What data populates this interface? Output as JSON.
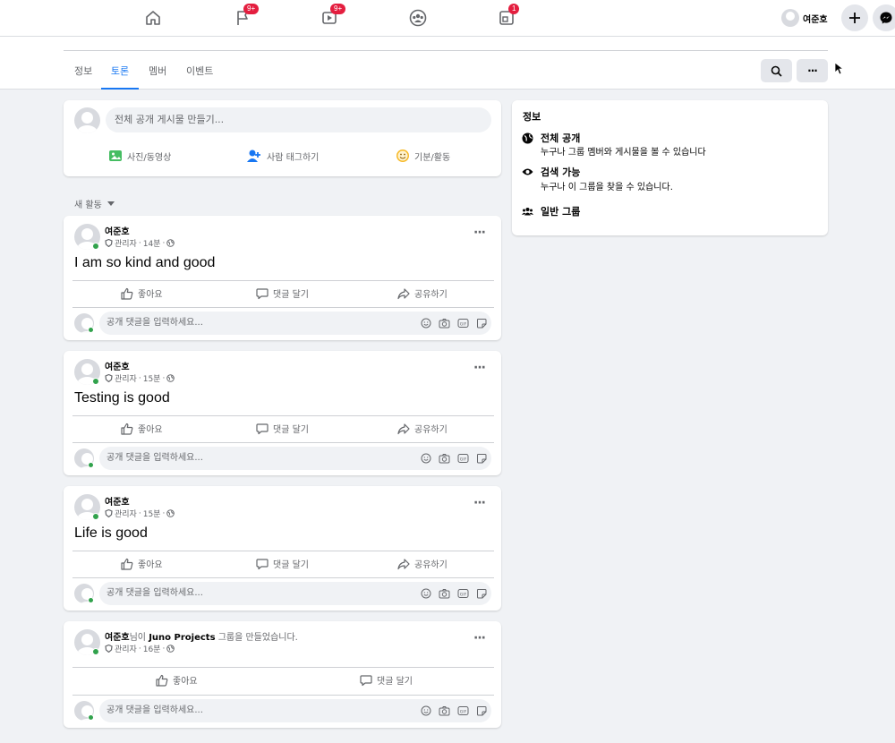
{
  "nav": {
    "badges": [
      "9+",
      "9+",
      "1"
    ],
    "profile_name": "여준호"
  },
  "tabs": [
    "정보",
    "토론",
    "멤버",
    "이벤트"
  ],
  "composer": {
    "placeholder": "전체 공개 게시물 만들기...",
    "actions": [
      "사진/동영상",
      "사람 태그하기",
      "기분/활동"
    ]
  },
  "sort_label": "새 활동",
  "posts": [
    {
      "author": "여준호",
      "role": "관리자",
      "time": "14분",
      "text": "I am so kind and good",
      "like": "좋아요",
      "comment": "댓글 달기",
      "share": "공유하기",
      "comment_placeholder": "공개 댓글을 입력하세요..."
    },
    {
      "author": "여준호",
      "role": "관리자",
      "time": "15분",
      "text": "Testing is good",
      "like": "좋아요",
      "comment": "댓글 달기",
      "share": "공유하기",
      "comment_placeholder": "공개 댓글을 입력하세요..."
    },
    {
      "author": "여준호",
      "role": "관리자",
      "time": "15분",
      "text": "Life is good",
      "like": "좋아요",
      "comment": "댓글 달기",
      "share": "공유하기",
      "comment_placeholder": "공개 댓글을 입력하세요..."
    },
    {
      "author": "여준호",
      "author_suffix": "님이",
      "group": "Juno Projects",
      "action": "그룹을 만들었습니다.",
      "role": "관리자",
      "time": "16분",
      "like": "좋아요",
      "comment": "댓글 달기",
      "comment_placeholder": "공개 댓글을 입력하세요..."
    }
  ],
  "about": {
    "title": "정보",
    "items": [
      {
        "title": "전체 공개",
        "desc": "누구나 그룹 멤버와 게시물을 볼 수 있습니다",
        "icon": "globe-icon"
      },
      {
        "title": "검색 가능",
        "desc": "누구나 이 그룹을 찾을 수 있습니다.",
        "icon": "eye-icon"
      },
      {
        "title": "일반 그룹",
        "icon": "people-icon"
      }
    ]
  }
}
